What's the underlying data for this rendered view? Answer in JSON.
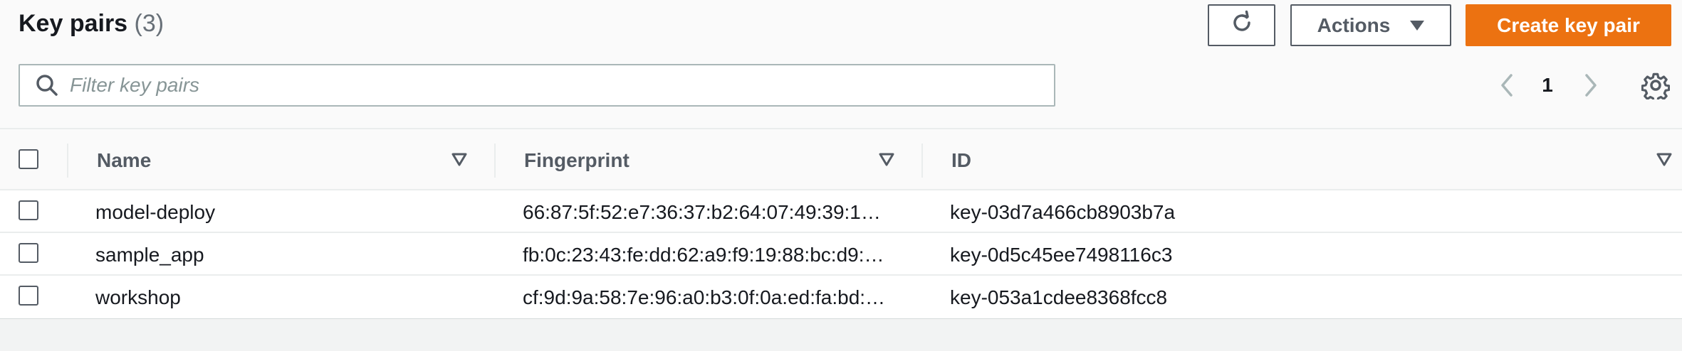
{
  "header": {
    "title": "Key pairs",
    "count": "(3)",
    "actions_label": "Actions",
    "create_label": "Create key pair"
  },
  "search": {
    "placeholder": "Filter key pairs",
    "value": ""
  },
  "pagination": {
    "current_page": "1"
  },
  "table": {
    "columns": [
      "Name",
      "Fingerprint",
      "ID"
    ],
    "rows": [
      {
        "name": "model-deploy",
        "fingerprint": "66:87:5f:52:e7:36:37:b2:64:07:49:39:1…",
        "id": "key-03d7a466cb8903b7a"
      },
      {
        "name": "sample_app",
        "fingerprint": "fb:0c:23:43:fe:dd:62:a9:f9:19:88:bc:d9:…",
        "id": "key-0d5c45ee7498116c3"
      },
      {
        "name": "workshop",
        "fingerprint": "cf:9d:9a:58:7e:96:a0:b3:0f:0a:ed:fa:bd:…",
        "id": "key-053a1cdee8368fcc8"
      }
    ]
  },
  "colors": {
    "primary_button": "#ec7211",
    "border": "#545b64",
    "muted_text": "#687078"
  },
  "icons": {
    "refresh": "refresh-icon",
    "search": "search-icon",
    "settings": "gear-icon",
    "sort": "sort-down-icon",
    "prev": "chevron-left-icon",
    "next": "chevron-right-icon"
  }
}
